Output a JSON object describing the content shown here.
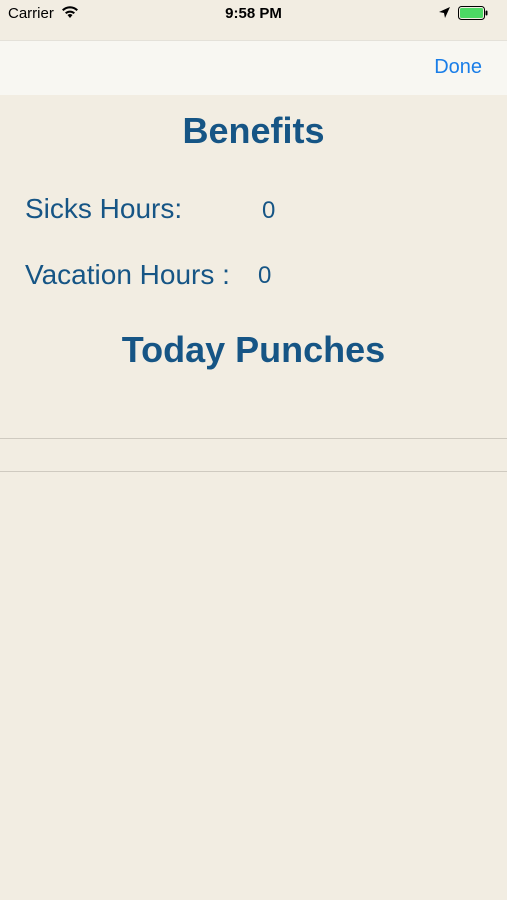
{
  "status_bar": {
    "carrier": "Carrier",
    "time": "9:58 PM",
    "icons": [
      "wifi-icon",
      "location-icon",
      "battery-icon"
    ],
    "battery_color": "#4cd964"
  },
  "nav": {
    "done_label": "Done",
    "accent_color": "#1a7ee8"
  },
  "benefits": {
    "title": "Benefits",
    "sick_label": "Sicks Hours:",
    "sick_value": "0",
    "vacation_label": "Vacation Hours :",
    "vacation_value": "0"
  },
  "punches": {
    "title": "Today Punches",
    "items": []
  },
  "theme": {
    "background": "#f2ede2",
    "text_color": "#165585"
  }
}
